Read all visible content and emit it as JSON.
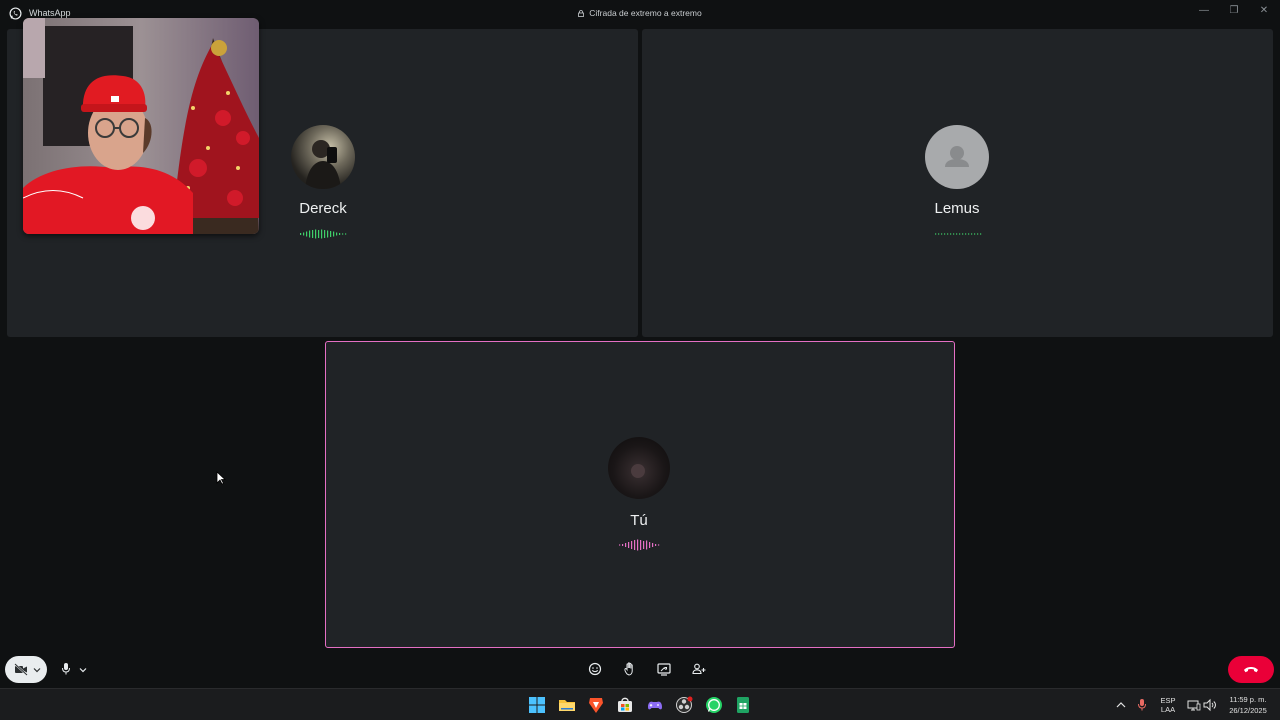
{
  "app": {
    "name": "WhatsApp",
    "encryption_notice": "Cifrada de extremo a extremo"
  },
  "window_controls": {
    "minimize": "—",
    "restore": "❐",
    "close": "✕"
  },
  "participants": [
    {
      "name": "Dereck",
      "speaking": true,
      "wave_color": "#3fcf6a"
    },
    {
      "name": "Lemus",
      "speaking": false,
      "wave_color": "#3fcf6a"
    },
    {
      "name": "Tú",
      "speaking": true,
      "wave_color": "#e46fc4"
    }
  ],
  "controls": {
    "camera": "camera-off-icon",
    "mic": "microphone-icon",
    "center": [
      "emoji-icon",
      "raise-hand-icon",
      "share-screen-icon",
      "participants-icon"
    ],
    "end": "end-call-icon"
  },
  "taskbar": {
    "language_top": "ESP",
    "language_bottom": "LAA",
    "time": "11:59 p. m.",
    "date": "26/12/2025",
    "apps": [
      "start-icon",
      "file-explorer-icon",
      "brave-icon",
      "store-icon",
      "game-icon",
      "obs-icon",
      "whatsapp-icon",
      "sheets-icon"
    ]
  },
  "colors": {
    "accent_green": "#3fcf6a",
    "speaker_pink": "#e46fc4",
    "end_red": "#ea0038"
  }
}
